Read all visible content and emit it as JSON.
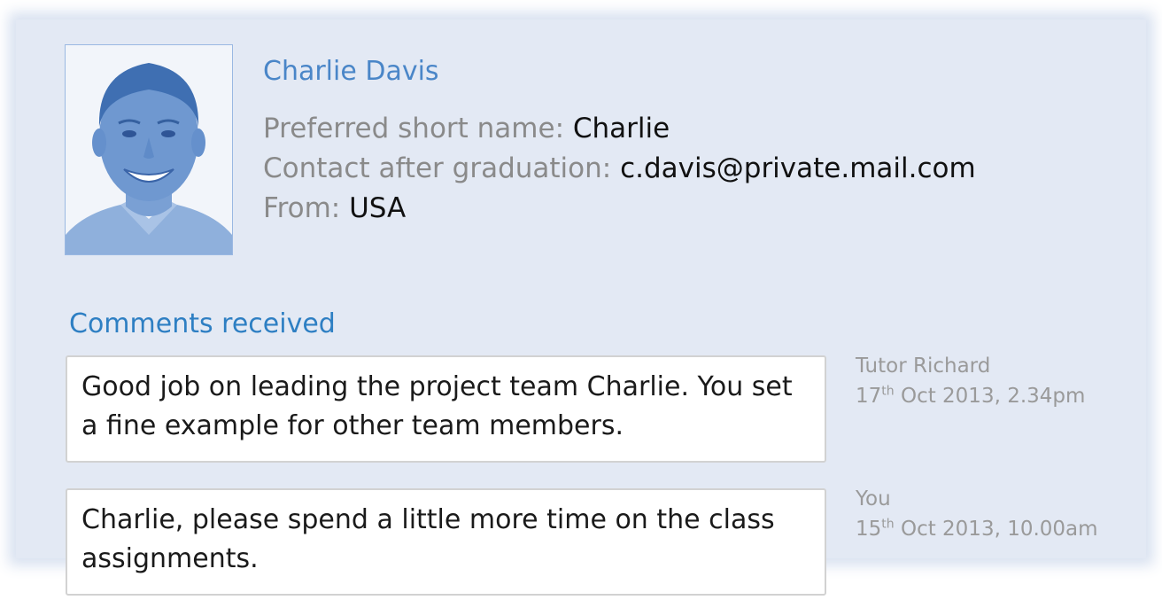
{
  "profile": {
    "name": "Charlie Davis",
    "photo_alt": "profile-photo",
    "fields": [
      {
        "label": "Preferred short name: ",
        "value": "Charlie"
      },
      {
        "label": "Contact after graduation: ",
        "value": "c.davis@private.mail.com"
      },
      {
        "label": "From: ",
        "value": "USA"
      }
    ]
  },
  "comments": {
    "title": "Comments received",
    "items": [
      {
        "text": "Good job on leading the project team Charlie. You set a fine example for other team members.",
        "author": "Tutor Richard",
        "date_day": "17",
        "date_suffix": "th",
        "date_rest": " Oct 2013, 2.34pm"
      },
      {
        "text": "Charlie, please spend a little more time on the class assignments.",
        "author": "You",
        "date_day": "15",
        "date_suffix": "th",
        "date_rest": " Oct 2013, 10.00am"
      }
    ]
  },
  "colors": {
    "panel_bg": "#e3e9f4",
    "name_blue": "#4a86c8",
    "title_blue": "#2e7fc3",
    "label_gray": "#8a8a8a"
  }
}
